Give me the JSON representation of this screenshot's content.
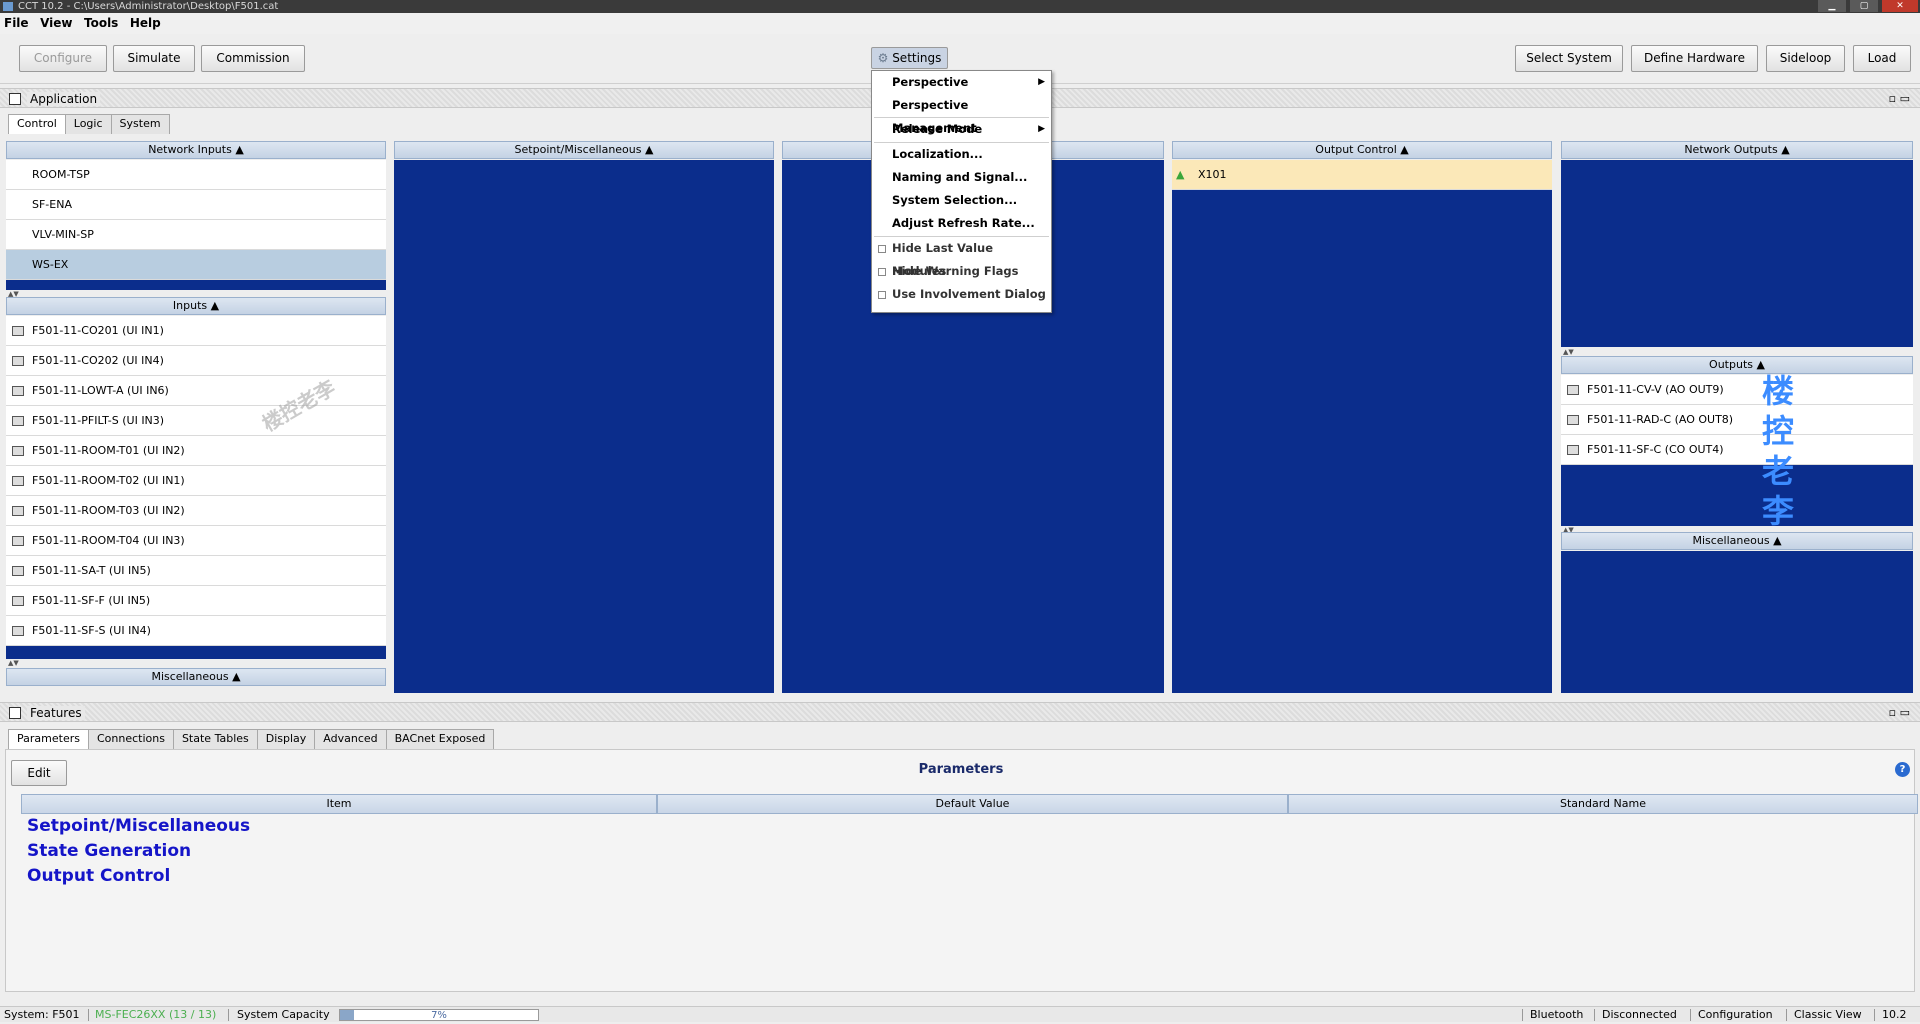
{
  "window": {
    "title": "CCT 10.2 - C:\\Users\\Administrator\\Desktop\\F501.cat"
  },
  "menubar": [
    "File",
    "View",
    "Tools",
    "Help"
  ],
  "toolbar": {
    "configure": "Configure",
    "simulate": "Simulate",
    "commission": "Commission",
    "settings": "Settings",
    "select_system": "Select System",
    "define_hardware": "Define Hardware",
    "sideloop": "Sideloop",
    "load": "Load"
  },
  "settings_menu": {
    "perspective": "Perspective",
    "perspective_management": "Perspective Management",
    "release_mode": "Release Mode",
    "localization": "Localization...",
    "naming_and_signal": "Naming and Signal...",
    "system_selection": "System Selection...",
    "adjust_refresh_rate": "Adjust Refresh Rate...",
    "hide_last_value_modules": "Hide Last Value Modules",
    "hide_warning_flags": "Hide Warning Flags",
    "use_involvement_dialog": "Use Involvement Dialog"
  },
  "application": {
    "title": "Application",
    "tabs": [
      "Control",
      "Logic",
      "System"
    ],
    "active_tab": "Control",
    "network_inputs": {
      "header": "Network Inputs ▲",
      "items": [
        "ROOM-TSP",
        "SF-ENA",
        "VLV-MIN-SP",
        "WS-EX"
      ],
      "selected": "WS-EX"
    },
    "inputs": {
      "header": "Inputs ▲",
      "items": [
        "F501-11-CO201 (UI IN1)",
        "F501-11-CO202 (UI IN4)",
        "F501-11-LOWT-A (UI IN6)",
        "F501-11-PFILT-S (UI IN3)",
        "F501-11-ROOM-T01 (UI IN2)",
        "F501-11-ROOM-T02 (UI IN1)",
        "F501-11-ROOM-T03 (UI IN2)",
        "F501-11-ROOM-T04 (UI IN3)",
        "F501-11-SA-T (UI IN5)",
        "F501-11-SF-F (UI IN5)",
        "F501-11-SF-S (UI IN4)"
      ]
    },
    "misc_left": {
      "header": "Miscellaneous ▲"
    },
    "setpoint": {
      "header": "Setpoint/Miscellaneous ▲"
    },
    "output_control": {
      "header": "Output Control ▲",
      "items": [
        "X101"
      ]
    },
    "network_outputs": {
      "header": "Network Outputs ▲"
    },
    "outputs": {
      "header": "Outputs ▲",
      "items": [
        "F501-11-CV-V (AO OUT9)",
        "F501-11-RAD-C (AO OUT8)",
        "F501-11-SF-C (CO OUT4)"
      ]
    },
    "misc_right": {
      "header": "Miscellaneous ▲"
    }
  },
  "features": {
    "title": "Features",
    "tabs": [
      "Parameters",
      "Connections",
      "State Tables",
      "Display",
      "Advanced",
      "BACnet Exposed"
    ],
    "active_tab": "Parameters",
    "edit": "Edit",
    "heading": "Parameters",
    "columns": [
      "Item",
      "Default Value",
      "Standard Name"
    ],
    "groups": [
      "Setpoint/Miscellaneous",
      "State Generation",
      "Output Control"
    ]
  },
  "watermark": {
    "vertical_chars": [
      "楼",
      "控",
      "老",
      "李"
    ],
    "diagonal": "楼控老李"
  },
  "statusbar": {
    "system": "System: F501",
    "controller": "MS-FEC26XX (13 / 13)",
    "capacity_label": "System Capacity",
    "capacity_text": "7%",
    "capacity_value": 0.07,
    "bluetooth": "Bluetooth",
    "connection": "Disconnected",
    "mode": "Configuration",
    "view": "Classic View",
    "version": "10.2"
  },
  "colors": {
    "panel_blue": "#0b2d8c",
    "controller_green": "#4caf50",
    "link_blue": "#1515c8"
  }
}
